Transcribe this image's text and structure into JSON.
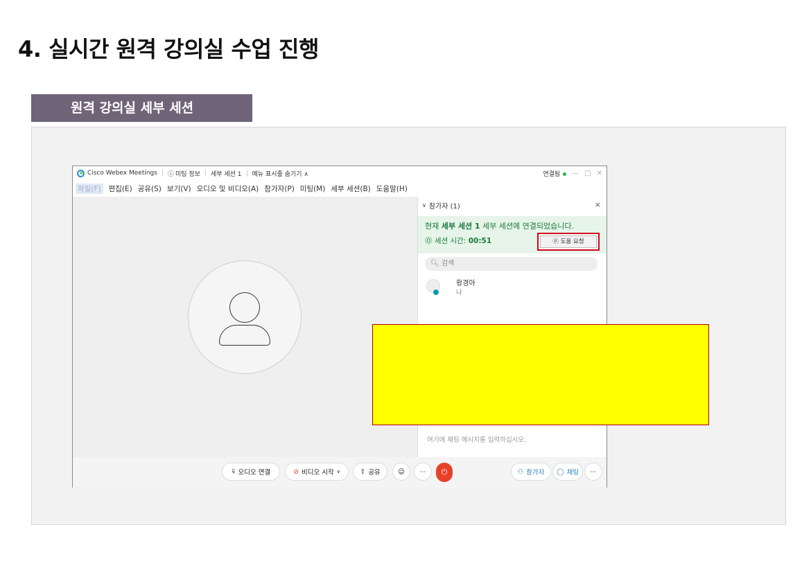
{
  "slide": {
    "title": "4. 실시간 원격 강의실 수업 진행",
    "section_label": "원격 강의실 세부 세션"
  },
  "window": {
    "app_name": "Cisco Webex Meetings",
    "meeting_info": "미팅 정보",
    "session_name": "세부 세션 1",
    "hide_menu": "메뉴 표시줄 숨기기 ∧",
    "connected": "연결됨",
    "menu": [
      "파일(F)",
      "편집(E)",
      "공유(S)",
      "보기(V)",
      "오디오 및 비디오(A)",
      "참가자(P)",
      "미팅(M)",
      "세부 세션(B)",
      "도움말(H)"
    ]
  },
  "panel": {
    "header": "참가자 (1)",
    "close": "×",
    "notice_prefix": "현재 ",
    "notice_bold": "세부 세션 1",
    "notice_suffix": " 세부 세션에 연결되었습니다.",
    "timer_label": "세션 시간: ",
    "timer_value": "00:51",
    "help_button": "도움 요청",
    "search_placeholder": "검색",
    "participant_name": "황경아",
    "participant_sub": "나",
    "chat_placeholder": "여기에 채팅 메시지를 입력하십시오."
  },
  "toolbar": {
    "audio": "오디오 연결",
    "video": "비디오 시작",
    "share": "공유",
    "participants": "참가자",
    "chat": "채팅"
  },
  "colors": {
    "section_bg": "#6f6478",
    "highlight_border": "#d0021b",
    "notice_green": "#1d7a3a",
    "end_button": "#e8412a",
    "overlay_yellow": "#ffff00"
  }
}
